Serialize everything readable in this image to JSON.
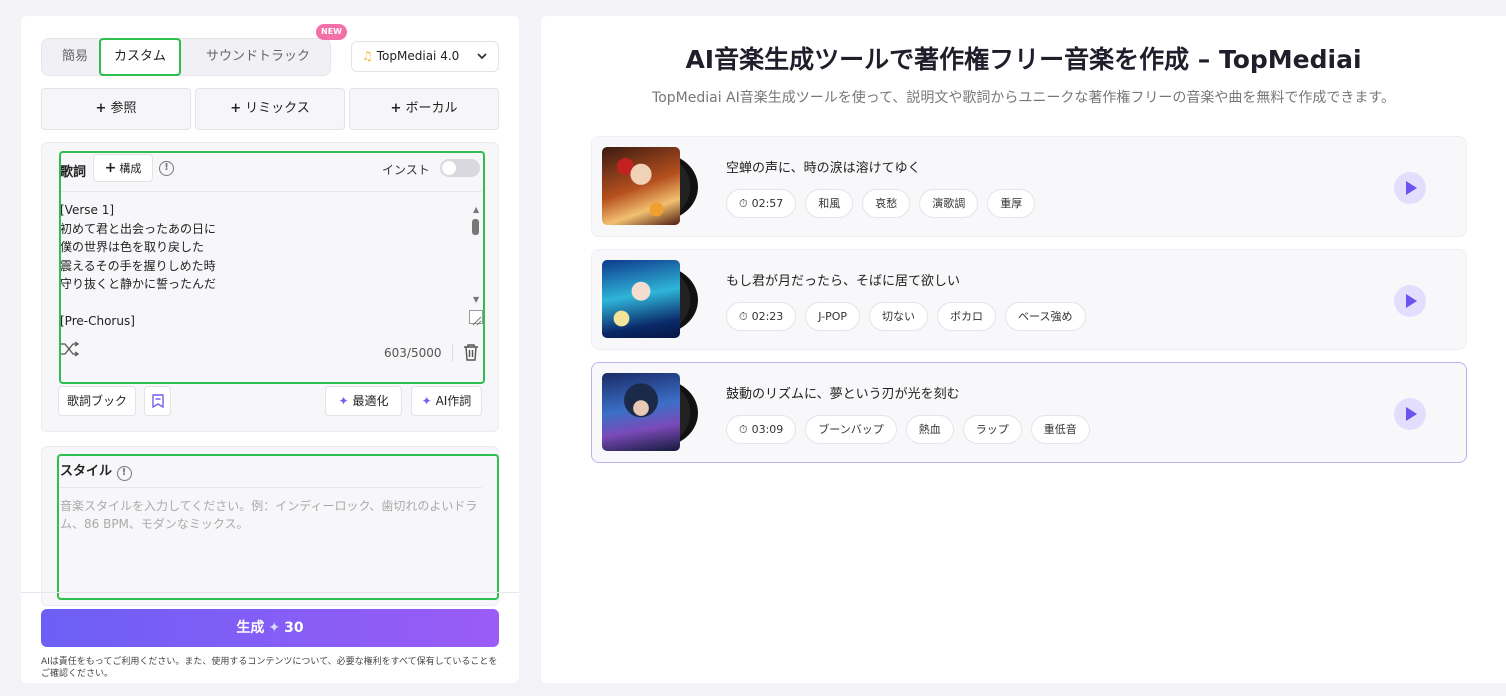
{
  "tabs": [
    {
      "label": "簡易"
    },
    {
      "label": "カスタム"
    },
    {
      "label": "サウンドトラック"
    }
  ],
  "new_badge": "NEW",
  "model_select": {
    "value": "TopMediai 4.0",
    "note_icon": "music-note-icon"
  },
  "add_buttons": [
    {
      "label": "参照"
    },
    {
      "label": "リミックス"
    },
    {
      "label": "ボーカル"
    }
  ],
  "lyrics": {
    "label": "歌詞",
    "structure_button": "構成",
    "instrumental_label": "インスト",
    "instrumental_on": false,
    "text": "[Verse 1]\n初めて君と出会ったあの日に\n僕の世界は色を取り戻した\n震えるその手を握りしめた時\n守り抜くと静かに誓ったんだ\n\n[Pre-Chorus]",
    "counter": "603/5000"
  },
  "lyrics_actions": {
    "lyrics_book": "歌詞ブック",
    "optimize": "最適化",
    "ai_write": "AI作詞"
  },
  "style": {
    "label": "スタイル",
    "placeholder": "音楽スタイルを入力してください。例：インディーロック、歯切れのよいドラム、86 BPM、モダンなミックス。"
  },
  "generate": {
    "label": "生成",
    "cost": "30"
  },
  "disclaimer": "AIは責任をもってご利用ください。また、使用するコンテンツについて、必要な権利をすべて保有していることをご確認ください。",
  "header": {
    "title": "AI音楽生成ツールで著作権フリー音楽を作成 – TopMediai",
    "subtitle": "TopMediai AI音楽生成ツールを使って、説明文や歌詞からユニークな著作権フリーの音楽や曲を無料で作成できます。"
  },
  "songs": [
    {
      "title": "空蝉の声に、時の涙は溶けてゆく",
      "duration": "02:57",
      "tags": [
        "和風",
        "哀愁",
        "演歌調",
        "重厚"
      ]
    },
    {
      "title": "もし君が月だったら、そばに居て欲しい",
      "duration": "02:23",
      "tags": [
        "J-POP",
        "切ない",
        "ボカロ",
        "ベース強め"
      ]
    },
    {
      "title": "鼓動のリズムに、夢という刃が光を刻む",
      "duration": "03:09",
      "tags": [
        "ブーンバップ",
        "熱血",
        "ラップ",
        "重低音"
      ]
    }
  ],
  "colors": {
    "accent": "#6c5ff5",
    "highlight": "#2fbf4f",
    "badge": "#f26fa7"
  }
}
